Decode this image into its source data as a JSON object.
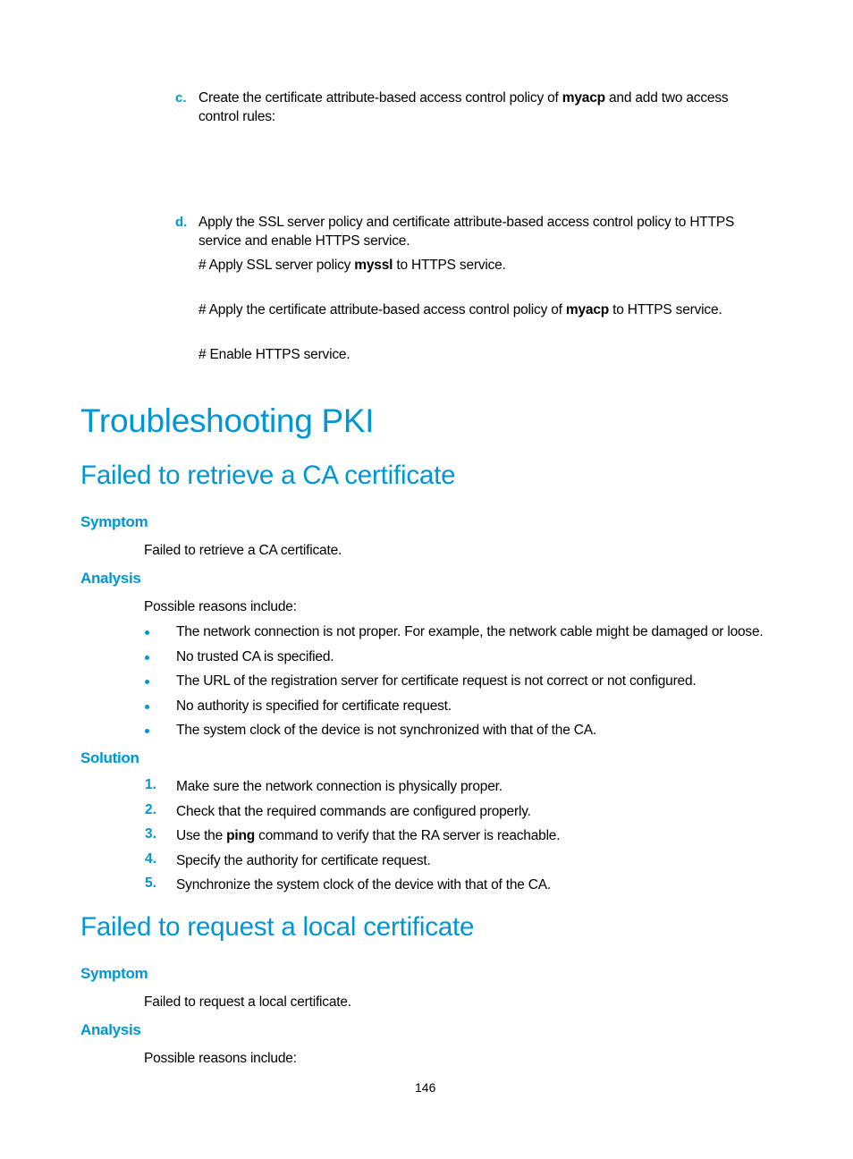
{
  "intro_steps": [
    {
      "label": "c.",
      "line1_pre": "Create the certificate attribute-based access control policy of ",
      "line1_bold": "myacp",
      "line1_post": " and add two access",
      "line2": "control rules:"
    },
    {
      "label": "d.",
      "line1": "Apply the SSL server policy and certificate attribute-based access control policy to HTTPS",
      "line2": "service and enable HTTPS service.",
      "comments": [
        {
          "pre": "# Apply SSL server policy ",
          "bold": "myssl",
          "post": " to HTTPS service."
        },
        {
          "pre": "# Apply the certificate attribute-based access control policy of ",
          "bold": "myacp",
          "post": " to HTTPS service."
        },
        {
          "pre": "# Enable HTTPS service.",
          "bold": "",
          "post": ""
        }
      ]
    }
  ],
  "chapter_title": "Troubleshooting PKI",
  "section1": {
    "title": "Failed to retrieve a CA certificate",
    "symptom_heading": "Symptom",
    "symptom_text": "Failed to retrieve a CA certificate.",
    "analysis_heading": "Analysis",
    "analysis_intro": "Possible reasons include:",
    "reasons": [
      "The network connection is not proper. For example, the network cable might be damaged or loose.",
      "No trusted CA is specified.",
      "The URL of the registration server for certificate request is not correct or not configured.",
      "No authority is specified for certificate request.",
      "The system clock of the device is not synchronized with that of the CA."
    ],
    "solution_heading": "Solution",
    "solutions": [
      {
        "num": "1.",
        "pre": "Make sure the network connection is physically proper.",
        "bold": "",
        "post": ""
      },
      {
        "num": "2.",
        "pre": "Check that the required commands are configured properly.",
        "bold": "",
        "post": ""
      },
      {
        "num": "3.",
        "pre": "Use the ",
        "bold": "ping",
        "post": " command to verify that the RA server is reachable."
      },
      {
        "num": "4.",
        "pre": "Specify the authority for certificate request.",
        "bold": "",
        "post": ""
      },
      {
        "num": "5.",
        "pre": "Synchronize the system clock of the device with that of the CA.",
        "bold": "",
        "post": ""
      }
    ]
  },
  "section2": {
    "title": "Failed to request a local certificate",
    "symptom_heading": "Symptom",
    "symptom_text": "Failed to request a local certificate.",
    "analysis_heading": "Analysis",
    "analysis_intro": "Possible reasons include:"
  },
  "page_number": "146"
}
